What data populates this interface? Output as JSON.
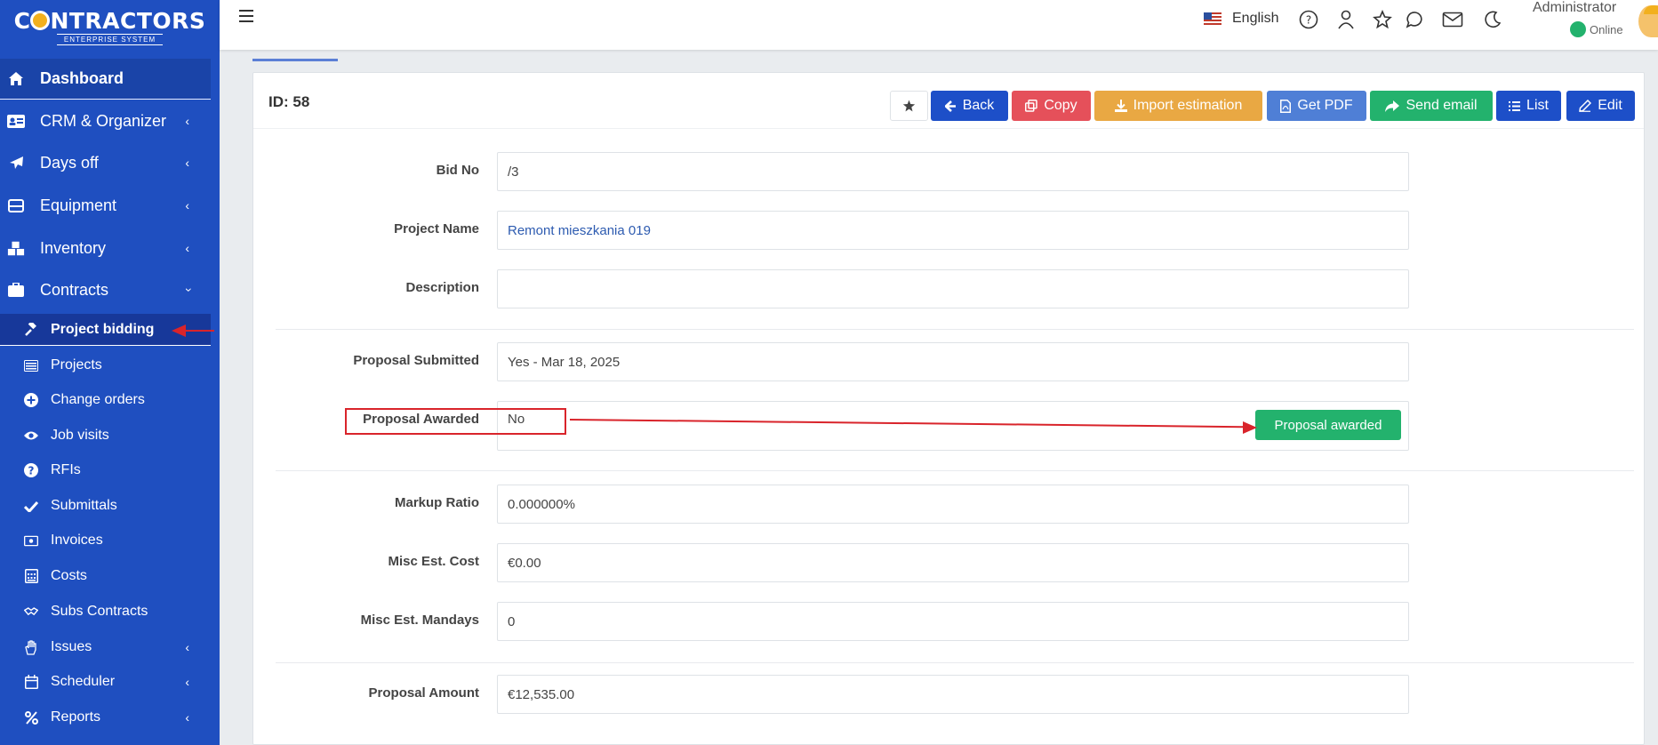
{
  "brand": {
    "title_pre": "C",
    "title_post": "NTRACTORS",
    "subtitle": "ENTERPRISE SYSTEM"
  },
  "sidebar": {
    "main_items": [
      {
        "label": "Dashboard",
        "icon": "home-icon"
      },
      {
        "label": "CRM & Organizer",
        "icon": "id-card-icon"
      },
      {
        "label": "Days off",
        "icon": "plane-icon"
      },
      {
        "label": "Equipment",
        "icon": "drawer-icon"
      },
      {
        "label": "Inventory",
        "icon": "boxes-icon"
      },
      {
        "label": "Contracts",
        "icon": "briefcase-icon"
      }
    ],
    "sub_items": [
      {
        "label": "Project bidding",
        "icon": "gavel-icon"
      },
      {
        "label": "Projects",
        "icon": "list-card-icon"
      },
      {
        "label": "Change orders",
        "icon": "plus-circle-icon"
      },
      {
        "label": "Job visits",
        "icon": "eye-icon"
      },
      {
        "label": "RFIs",
        "icon": "question-circle-icon"
      },
      {
        "label": "Submittals",
        "icon": "check-icon"
      },
      {
        "label": "Invoices",
        "icon": "money-icon"
      },
      {
        "label": "Costs",
        "icon": "calculator-icon"
      },
      {
        "label": "Subs Contracts",
        "icon": "handshake-icon"
      },
      {
        "label": "Issues",
        "icon": "hand-icon"
      },
      {
        "label": "Scheduler",
        "icon": "calendar-icon"
      },
      {
        "label": "Reports",
        "icon": "percent-icon"
      }
    ]
  },
  "topbar": {
    "language": "English",
    "user_name": "Administrator",
    "status": "Online"
  },
  "record": {
    "id_label": "ID: 58"
  },
  "actions": {
    "back": "Back",
    "copy": "Copy",
    "import": "Import estimation",
    "pdf": "Get PDF",
    "email": "Send email",
    "list": "List",
    "edit": "Edit"
  },
  "fields": {
    "bid_no": {
      "label": "Bid No",
      "value": "/3"
    },
    "project_name": {
      "label": "Project Name",
      "value": "Remont mieszkania 019"
    },
    "description": {
      "label": "Description",
      "value": ""
    },
    "proposal_submitted": {
      "label": "Proposal Submitted",
      "value": "Yes - Mar 18, 2025"
    },
    "proposal_awarded": {
      "label": "Proposal Awarded",
      "value": "No",
      "button": "Proposal awarded"
    },
    "markup_ratio": {
      "label": "Markup Ratio",
      "value": "0.000000%"
    },
    "misc_est_cost": {
      "label": "Misc Est. Cost",
      "value": "€0.00"
    },
    "misc_est_mandays": {
      "label": "Misc Est. Mandays",
      "value": "0"
    },
    "proposal_amount": {
      "label": "Proposal Amount",
      "value": "€12,535.00"
    }
  },
  "colors": {
    "sidebar": "#1f4fc0",
    "primary": "#1d4fc8",
    "danger": "#e5505a",
    "warning": "#e9a843",
    "info": "#4f7fd6",
    "success": "#23b26d",
    "annotation": "#d9242b"
  }
}
